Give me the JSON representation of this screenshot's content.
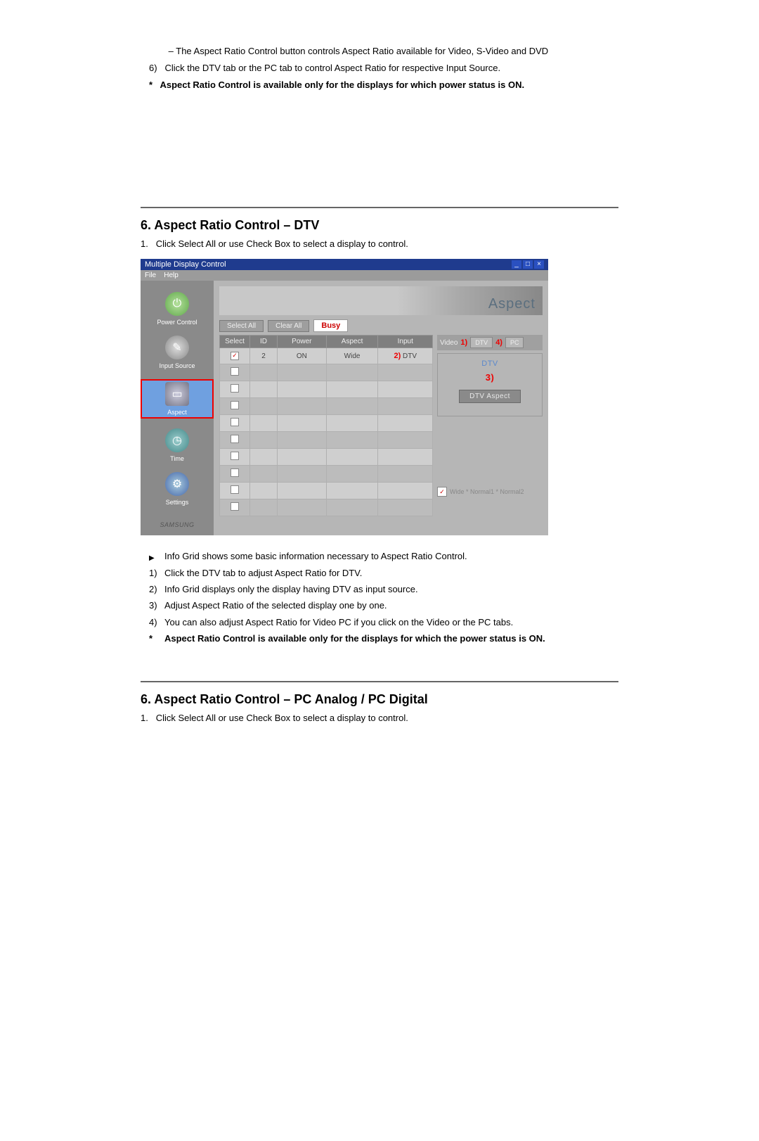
{
  "intro": {
    "dash": "–",
    "line1": "The Aspect Ratio Control button controls Aspect Ratio available for Video, S-Video and DVD",
    "marker6": "6)",
    "line2": "Click the DTV tab or the PC tab to control Aspect Ratio for respective Input Source.",
    "star": "*",
    "note": "Aspect Ratio Control is available only for the displays for which power status is ON."
  },
  "section1": {
    "title": "6. Aspect Ratio Control – DTV",
    "step_no": "1.",
    "step_text": "Click Select All or use Check Box to select a display to control."
  },
  "shot": {
    "window_title": "Multiple Display Control",
    "menu_file": "File",
    "menu_help": "Help",
    "header_right": "Aspect",
    "sidebar": {
      "power": "Power Control",
      "input": "Input Source",
      "aspect": "Aspect",
      "time": "Time",
      "settings": "Settings",
      "brand": "SAMSUNG"
    },
    "toolbar": {
      "select_all": "Select All",
      "clear_all": "Clear All",
      "busy": "Busy"
    },
    "columns": {
      "select": "Select",
      "id": "ID",
      "power": "Power",
      "aspect": "Aspect",
      "input": "Input"
    },
    "row1": {
      "id": "2",
      "power": "ON",
      "aspect": "Wide",
      "input_annot": "2)",
      "input": "DTV"
    },
    "right": {
      "video_label": "Video",
      "annot1": "1)",
      "tab_dtv": "DTV",
      "annot4": "4)",
      "tab_pc": "PC",
      "box_title": "DTV",
      "annot3": "3)",
      "btn": "DTV Aspect",
      "status_text": "Wide *  Normal1 * Normal2"
    }
  },
  "under": {
    "bullet": "▶",
    "l0": "Info Grid shows some basic information necessary to Aspect Ratio Control.",
    "m1": "1)",
    "l1": "Click the DTV tab to adjust Aspect Ratio for DTV.",
    "m2": "2)",
    "l2": "Info Grid displays only the display having DTV as input source.",
    "m3": "3)",
    "l3": "Adjust Aspect Ratio of the selected display one by one.",
    "m4": "4)",
    "l4": "You can also adjust Aspect Ratio for Video PC if you click on the Video or the PC tabs.",
    "star": "*",
    "note": "Aspect Ratio Control is available only for the displays for which the power status is ON."
  },
  "section2": {
    "title": "6. Aspect Ratio Control – PC Analog / PC Digital",
    "step_no": "1.",
    "step_text": "Click Select All or use Check Box to select a display to control."
  },
  "chart_data": {
    "type": "table",
    "columns": [
      "Select",
      "ID",
      "Power",
      "Aspect",
      "Input"
    ],
    "rows": [
      {
        "Select": true,
        "ID": "2",
        "Power": "ON",
        "Aspect": "Wide",
        "Input": "DTV"
      },
      {
        "Select": false,
        "ID": "",
        "Power": "",
        "Aspect": "",
        "Input": ""
      },
      {
        "Select": false,
        "ID": "",
        "Power": "",
        "Aspect": "",
        "Input": ""
      },
      {
        "Select": false,
        "ID": "",
        "Power": "",
        "Aspect": "",
        "Input": ""
      },
      {
        "Select": false,
        "ID": "",
        "Power": "",
        "Aspect": "",
        "Input": ""
      },
      {
        "Select": false,
        "ID": "",
        "Power": "",
        "Aspect": "",
        "Input": ""
      },
      {
        "Select": false,
        "ID": "",
        "Power": "",
        "Aspect": "",
        "Input": ""
      },
      {
        "Select": false,
        "ID": "",
        "Power": "",
        "Aspect": "",
        "Input": ""
      },
      {
        "Select": false,
        "ID": "",
        "Power": "",
        "Aspect": "",
        "Input": ""
      },
      {
        "Select": false,
        "ID": "",
        "Power": "",
        "Aspect": "",
        "Input": ""
      }
    ]
  }
}
